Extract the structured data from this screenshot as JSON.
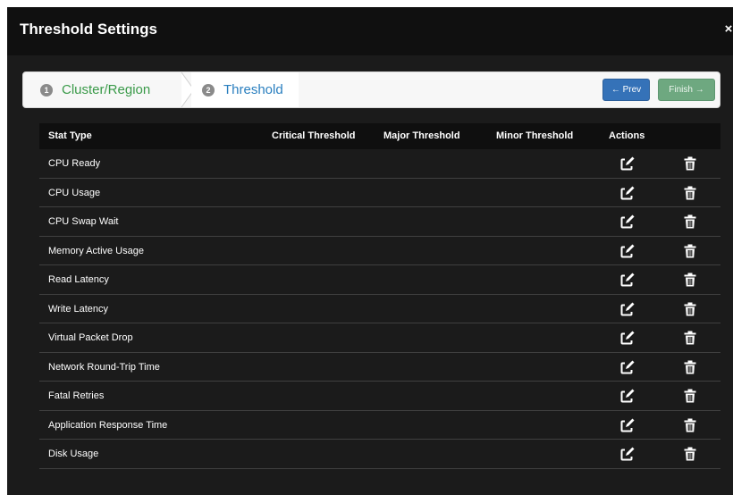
{
  "modal": {
    "title": "Threshold Settings",
    "close_label": "×"
  },
  "wizard": {
    "steps": [
      {
        "number": "1",
        "label": "Cluster/Region"
      },
      {
        "number": "2",
        "label": "Threshold"
      }
    ],
    "prev_label": "← Prev",
    "finish_label": "Finish →"
  },
  "table": {
    "headers": {
      "stat_type": "Stat Type",
      "critical": "Critical Threshold",
      "major": "Major Threshold",
      "minor": "Minor Threshold",
      "actions": "Actions"
    },
    "rows": [
      "CPU Ready",
      "CPU Usage",
      "CPU Swap Wait",
      "Memory Active Usage",
      "Read Latency",
      "Write Latency",
      "Virtual Packet Drop",
      "Network Round-Trip Time",
      "Fatal Retries",
      "Application Response Time",
      "Disk Usage"
    ]
  },
  "icons": {
    "edit": "edit-icon",
    "delete": "trash-icon"
  },
  "colors": {
    "modal_bg": "#1b1b1b",
    "header_bg": "#101010",
    "step_done": "#3a9a49",
    "step_active": "#2a7fbf",
    "prev_button": "#3572b8",
    "finish_button": "#6ea880"
  }
}
